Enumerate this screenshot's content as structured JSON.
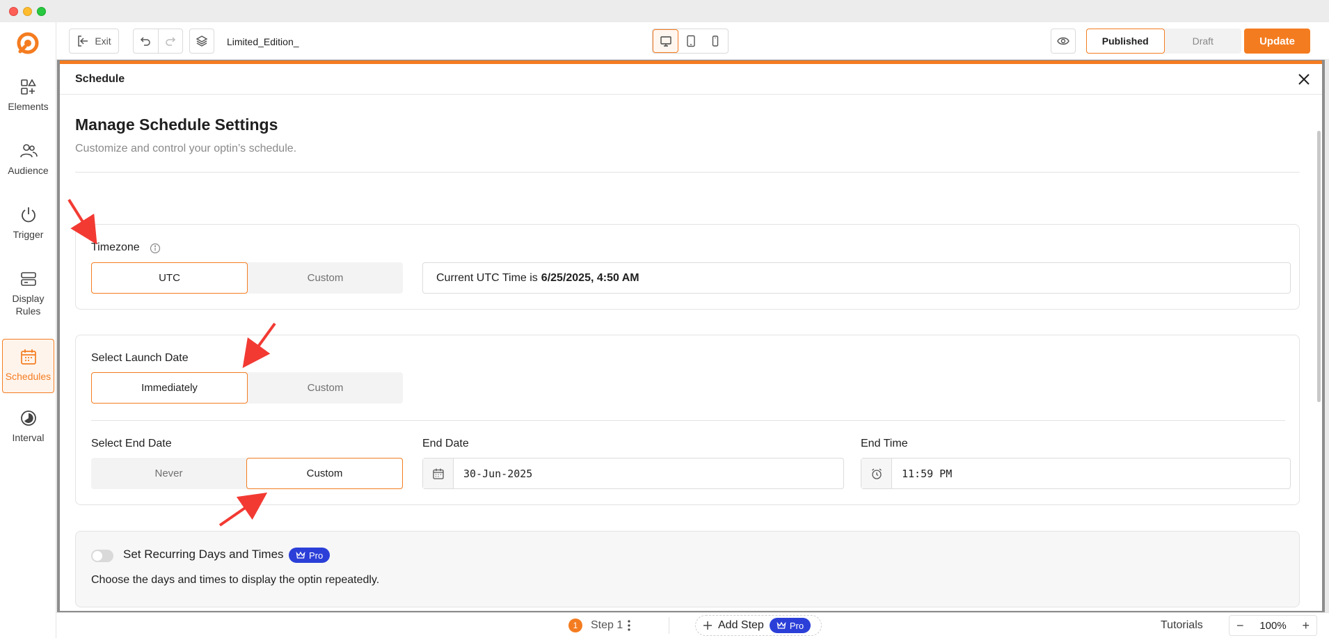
{
  "window": {
    "traffic_lights": [
      "close",
      "minimize",
      "zoom"
    ]
  },
  "brand": {
    "accent": "#f47c20",
    "pro_badge": "#2b3fd8"
  },
  "sidebar": {
    "items": [
      {
        "label": "Elements",
        "icon": "elements-icon"
      },
      {
        "label": "Audience",
        "icon": "audience-icon"
      },
      {
        "label": "Trigger",
        "icon": "power-icon"
      },
      {
        "label": "Display\nRules",
        "icon": "display-rules-icon"
      },
      {
        "label": "Schedules",
        "icon": "calendar-icon",
        "active": true
      },
      {
        "label": "Interval",
        "icon": "interval-icon"
      }
    ]
  },
  "toolbar": {
    "exit_label": "Exit",
    "filename": "Limited_Edition_",
    "published_label": "Published",
    "draft_label": "Draft",
    "update_label": "Update",
    "device_active": "desktop"
  },
  "modal": {
    "header_title": "Schedule",
    "title": "Manage Schedule Settings",
    "subtitle": "Customize and control your optin’s schedule."
  },
  "timezone": {
    "label": "Timezone",
    "options": [
      "UTC",
      "Custom"
    ],
    "selected": "UTC",
    "current_prefix": "Current UTC Time is",
    "current_value": "6/25/2025, 4:50 AM"
  },
  "launch": {
    "label": "Select Launch Date",
    "options": [
      "Immediately",
      "Custom"
    ],
    "selected": "Immediately"
  },
  "end": {
    "label": "Select End Date",
    "options": [
      "Never",
      "Custom"
    ],
    "selected": "Custom",
    "date_label": "End Date",
    "date_value": "30-Jun-2025",
    "time_label": "End Time",
    "time_value": "11:59 PM"
  },
  "recurring": {
    "title": "Set Recurring Days and Times",
    "pro_label": "Pro",
    "description": "Choose the days and times to display the optin repeatedly.",
    "enabled": false
  },
  "bottombar": {
    "step_number": "1",
    "step_label": "Step 1",
    "add_step_label": "Add Step",
    "pro_label": "Pro",
    "tutorials_label": "Tutorials",
    "zoom_minus": "−",
    "zoom_value": "100%",
    "zoom_plus": "+"
  }
}
